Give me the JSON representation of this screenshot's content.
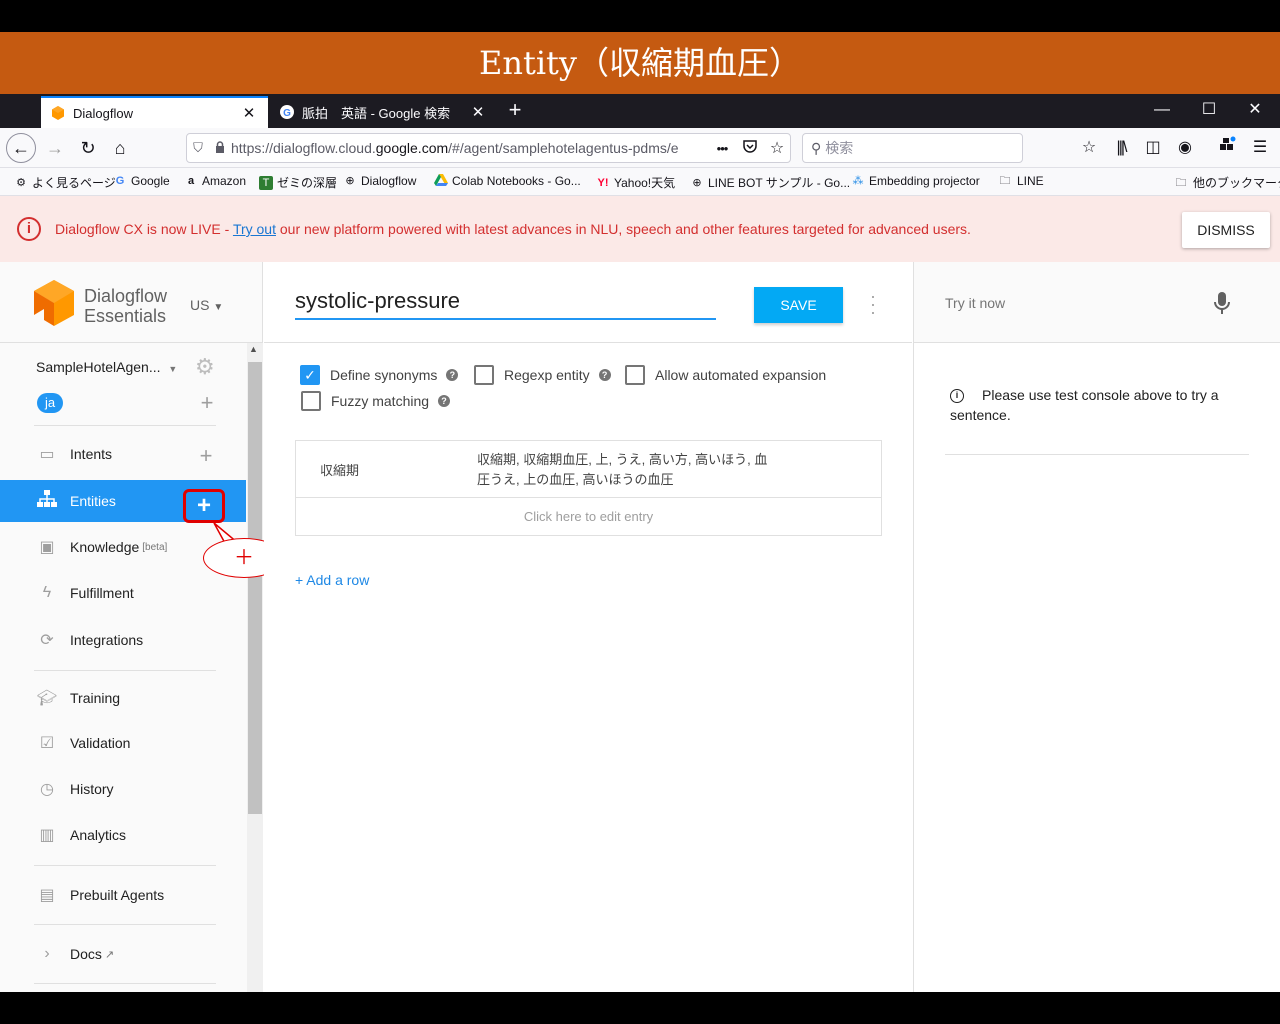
{
  "slide_title": "Entity（収縮期血圧）",
  "browser": {
    "tabs": [
      {
        "title": "Dialogflow",
        "close": "✕"
      },
      {
        "title": "脈拍　英語 - Google 検索",
        "close": "✕"
      }
    ],
    "new_tab": "+",
    "window_controls": {
      "minimize": "—",
      "maximize": "☐",
      "close": "✕"
    },
    "url_prefix": "https://dialogflow.cloud.",
    "url_domain": "google.com",
    "url_suffix": "/#/agent/samplehotelagentus-pdms/e",
    "url_more": "•••",
    "search_placeholder": "検索",
    "bookmarks": [
      {
        "label": "よく見るページ",
        "icon": "gear-icon"
      },
      {
        "label": "Google",
        "icon": "google-icon"
      },
      {
        "label": "Amazon",
        "icon": "amazon-icon"
      },
      {
        "label": "ゼミの深層",
        "icon": "zemi-icon"
      },
      {
        "label": "Dialogflow",
        "icon": "globe-icon"
      },
      {
        "label": "Colab Notebooks - Go...",
        "icon": "drive-icon"
      },
      {
        "label": "Yahoo!天気",
        "icon": "yahoo-icon"
      },
      {
        "label": "LINE BOT サンプル - Go...",
        "icon": "globe-icon"
      },
      {
        "label": "Embedding projector",
        "icon": "projector-icon"
      },
      {
        "label": "LINE",
        "icon": "folder-icon"
      }
    ],
    "other_bookmarks": "他のブックマーク"
  },
  "notice": {
    "text_before": "Dialogflow CX is now LIVE - ",
    "link": "Try out",
    "text_after": " our new platform powered with latest advances in NLU, speech and other features targeted for advanced users.",
    "dismiss": "DISMISS"
  },
  "sidebar": {
    "logo_line1": "Dialogflow",
    "logo_line2": "Essentials",
    "region": "US",
    "agent": "SampleHotelAgen...",
    "language": "ja",
    "items": [
      {
        "label": "Intents",
        "icon": "chat-icon"
      },
      {
        "label": "Entities",
        "icon": "hierarchy-icon"
      },
      {
        "label": "Knowledge",
        "badge": "[beta]",
        "icon": "book-icon"
      },
      {
        "label": "Fulfillment",
        "icon": "bolt-icon"
      },
      {
        "label": "Integrations",
        "icon": "sync-icon"
      },
      {
        "label": "Training",
        "icon": "graduation-cap-icon"
      },
      {
        "label": "Validation",
        "icon": "check-square-icon"
      },
      {
        "label": "History",
        "icon": "clock-icon"
      },
      {
        "label": "Analytics",
        "icon": "bar-chart-icon"
      },
      {
        "label": "Prebuilt Agents",
        "icon": "prebuilt-icon"
      },
      {
        "label": "Docs",
        "icon": "chevron-right-icon"
      }
    ],
    "add_symbol": "+",
    "callout_text": "＋"
  },
  "entity": {
    "name": "systolic-pressure",
    "save": "SAVE",
    "options": {
      "define_synonyms": "Define synonyms",
      "regexp_entity": "Regexp entity",
      "allow_expansion": "Allow automated expansion",
      "fuzzy_matching": "Fuzzy matching"
    },
    "entries": [
      {
        "reference": "収縮期",
        "synonyms_line1": "収縮期, 収縮期血圧, 上, うえ, 高い方, 高いほう, 血",
        "synonyms_line2": "圧うえ, 上の血圧, 高いほうの血圧"
      }
    ],
    "edit_placeholder": "Click here to edit entry",
    "add_row": "+ Add a row"
  },
  "console": {
    "try_placeholder": "Try it now",
    "message_line1": "Please use test console above to try a",
    "message_line2": "sentence."
  }
}
